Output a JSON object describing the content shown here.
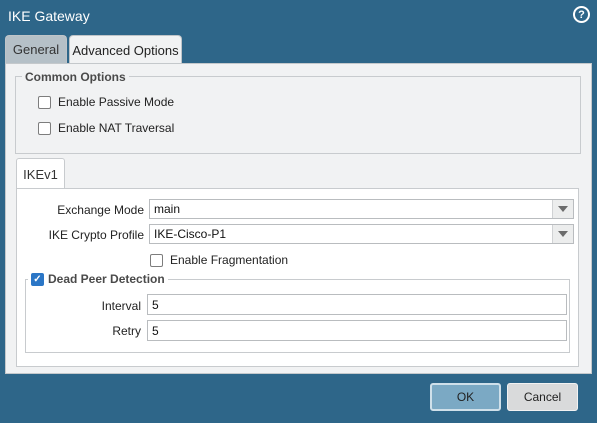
{
  "window": {
    "title": "IKE Gateway",
    "help_icon": "question-circle-icon",
    "help_glyph": "?"
  },
  "tabs": [
    {
      "label": "General",
      "selected": false
    },
    {
      "label": "Advanced Options",
      "selected": true
    }
  ],
  "common_options": {
    "legend": "Common Options",
    "passive_mode": {
      "label": "Enable Passive Mode",
      "checked": false
    },
    "nat_traversal": {
      "label": "Enable NAT Traversal",
      "checked": false
    }
  },
  "ikev1": {
    "tab_label": "IKEv1",
    "exchange_mode": {
      "label": "Exchange Mode",
      "value": "main"
    },
    "crypto_profile": {
      "label": "IKE Crypto Profile",
      "value": "IKE-Cisco-P1"
    },
    "fragmentation": {
      "label": "Enable Fragmentation",
      "checked": false
    },
    "dead_peer_detection": {
      "label": "Dead Peer Detection",
      "checked": true,
      "interval": {
        "label": "Interval",
        "value": "5"
      },
      "retry": {
        "label": "Retry",
        "value": "5"
      }
    }
  },
  "footer": {
    "ok_label": "OK",
    "cancel_label": "Cancel"
  },
  "colors": {
    "window_bg": "#2e6689",
    "panel_bg": "#f1f2f3",
    "ok_button": "#7ba9c4",
    "checkbox_checked": "#2b76c6"
  }
}
